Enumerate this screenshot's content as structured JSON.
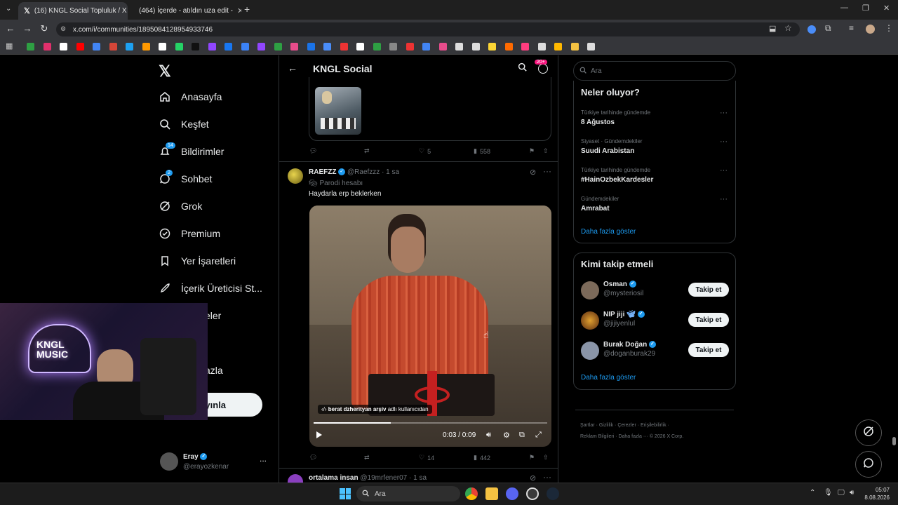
{
  "browser": {
    "tabs": [
      {
        "title": "(16) KNGL Social Topluluk / X",
        "active": true
      },
      {
        "title": "(464) İçerde - atıldın uza edit - ",
        "active": false
      }
    ],
    "url": "x.com/i/communities/1895084128954933746"
  },
  "sidebar": {
    "items": [
      {
        "label": "Anasayfa",
        "icon": "home-icon"
      },
      {
        "label": "Keşfet",
        "icon": "search-icon"
      },
      {
        "label": "Bildirimler",
        "icon": "bell-icon",
        "badge": "14"
      },
      {
        "label": "Sohbet",
        "icon": "chat-icon",
        "badge": "2"
      },
      {
        "label": "Grok",
        "icon": "grok-icon"
      },
      {
        "label": "Premium",
        "icon": "x-icon"
      },
      {
        "label": "Yer İşaretleri",
        "icon": "bookmark-icon"
      },
      {
        "label": "İçerik Üreticisi St...",
        "icon": "rocket-icon"
      },
      {
        "label": "eler",
        "icon": ""
      },
      {
        "label": "azla",
        "icon": ""
      }
    ],
    "post_button": "yayınla",
    "account": {
      "name": "Eray",
      "handle": "@erayozkenar",
      "more": "..."
    }
  },
  "header": {
    "title": "KNGL Social",
    "badge": "20+"
  },
  "posts": [
    {
      "reply": "",
      "repost": "",
      "like": "5",
      "views": "558"
    },
    {
      "name": "RAEFZZ",
      "handle": "@Raefzzz · 1 sa",
      "tag": "Parodi hesabı",
      "text": "Haydarla erp beklerken",
      "video": {
        "overlay": "berat dzherityan arşiv",
        "overlay_suffix": "adlı kullanıcıdan",
        "time": "0:03 / 0:09",
        "progress": 0.33
      },
      "reply": "",
      "repost": "",
      "like": "14",
      "views": "442"
    },
    {
      "name": "ortalama insan",
      "handle": "@19mrfener07 · 1 sa"
    }
  ],
  "right": {
    "search_placeholder": "Ara",
    "trends_title": "Neler oluyor?",
    "trends": [
      {
        "context": "Türkiye tarihinde gündemde",
        "title": "8 Ağustos"
      },
      {
        "context": "Siyaset · Gündemdekiler",
        "title": "Suudi Arabistan"
      },
      {
        "context": "Türkiye tarihinde gündemde",
        "title": "#HainOzbekKardesler"
      },
      {
        "context": "Gündemdekiler",
        "title": "Amrabat"
      }
    ],
    "show_more": "Daha fazla göster",
    "who_title": "Kimi takip etmeli",
    "who": [
      {
        "name": "Osman",
        "handle": "@mysteriosil"
      },
      {
        "name": "NIP jiji",
        "handle": "@jijiyenlul"
      },
      {
        "name": "Burak Doğan",
        "handle": "@doganburak29"
      }
    ],
    "follow_label": "Takip et",
    "who_more": "Daha fazla göster",
    "footer": [
      "Şartlar",
      "Gizlilik",
      "Çerezler",
      "Erişilebilirlik",
      "Reklam Bilgileri",
      "Daha fazla ···",
      "© 2026 X Corp."
    ]
  },
  "webcam": {
    "sign": "KNGL MUSIC"
  },
  "taskbar": {
    "search": "Ara",
    "time": "05:07",
    "date": "8.08.2026"
  },
  "colors": {
    "accent": "#1d9bf0",
    "bg": "#000000",
    "border": "#2f3336",
    "muted": "#71767b",
    "badge_pink": "#f91880"
  }
}
